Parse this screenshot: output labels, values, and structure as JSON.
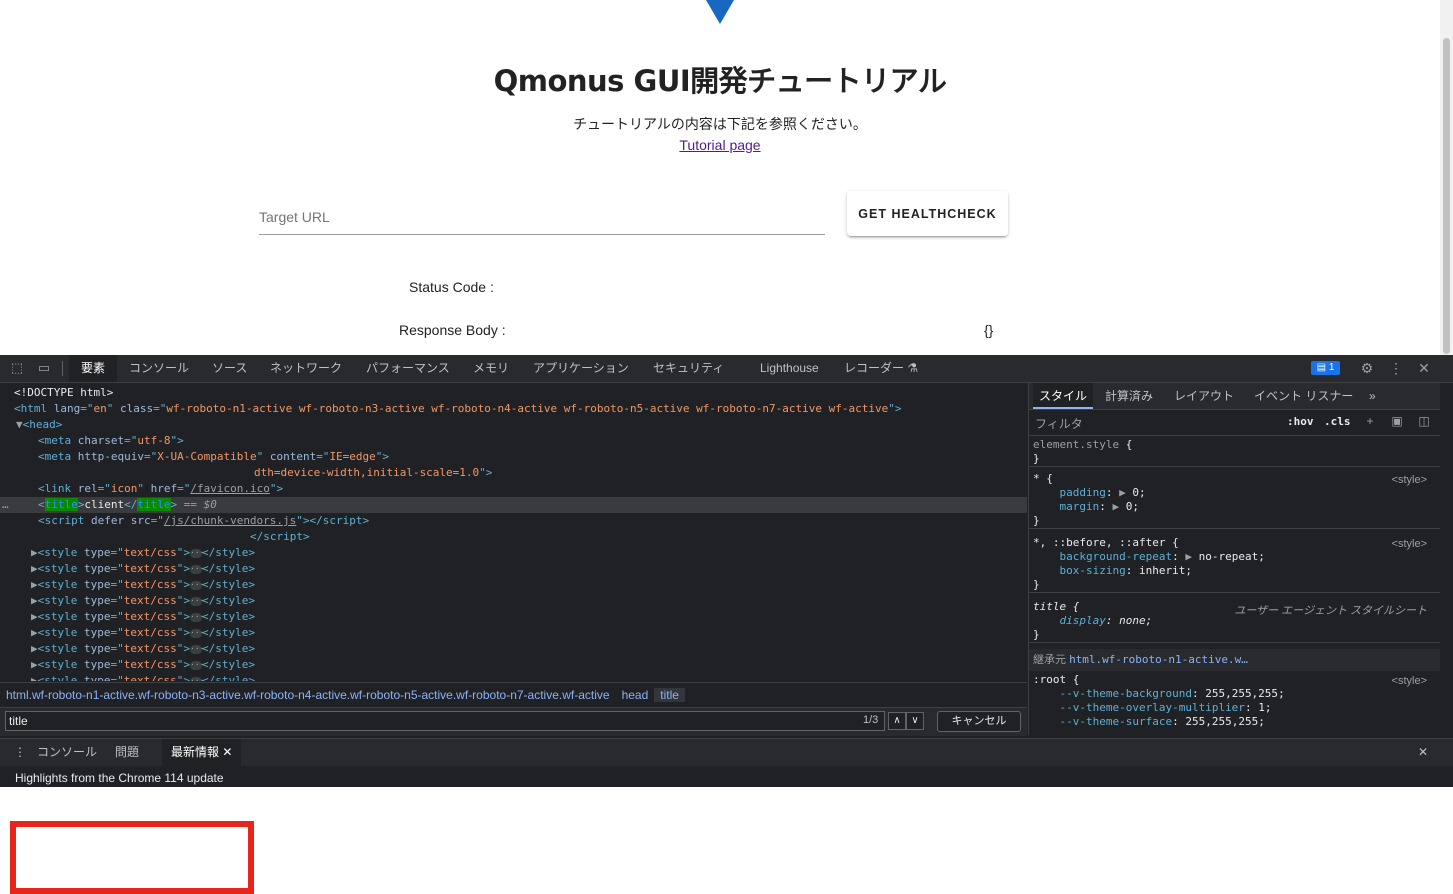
{
  "page": {
    "title": "Qmonus GUI開発チュートリアル",
    "description": "チュートリアルの内容は下記を参照ください。",
    "link": "Tutorial page",
    "url_placeholder": "Target URL",
    "healthcheck_button": "GET HEALTHCHECK",
    "status_label": "Status Code :",
    "response_label": "Response Body :",
    "response_value": "{}"
  },
  "devtools": {
    "tabs": [
      "要素",
      "コンソール",
      "ソース",
      "ネットワーク",
      "パフォーマンス",
      "メモリ",
      "アプリケーション",
      "セキュリティ",
      "Lighthouse",
      "レコーダー"
    ],
    "active_tab": "要素",
    "message_count": "1",
    "dom_lines": {
      "doctype": "<!DOCTYPE html>",
      "html_lang": "en",
      "html_class": "wf-roboto-n1-active wf-roboto-n3-active wf-roboto-n4-active wf-roboto-n5-active wf-roboto-n7-active wf-active",
      "meta_charset": "utf-8",
      "meta_http_equiv": "X-UA-Compatible",
      "meta_content": "IE=edge",
      "meta_viewport_tail": "dth=device-width,initial-scale=1.0",
      "link_rel": "icon",
      "link_href": "/favicon.ico",
      "title_text": "client",
      "selected_marker": "== $0",
      "script1_src": "/js/chunk-vendors.js",
      "script2_tail": "script>",
      "style_type": "text/css",
      "style_count": 9
    },
    "breadcrumbs": [
      "html.wf-roboto-n1-active.wf-roboto-n3-active.wf-roboto-n4-active.wf-roboto-n5-active.wf-roboto-n7-active.wf-active",
      "head",
      "title"
    ],
    "search": {
      "value": "title",
      "count": "1/3",
      "cancel": "キャンセル"
    },
    "styles": {
      "tabs": [
        "スタイル",
        "計算済み",
        "レイアウト",
        "イベント リスナー"
      ],
      "filter_placeholder": "フィルタ",
      "hov": ":hov",
      "cls": ".cls",
      "element_style": "element.style",
      "rule1_selector": "*",
      "rule1_source": "<style>",
      "rule1_props": [
        {
          "name": "padding",
          "value": "0"
        },
        {
          "name": "margin",
          "value": "0"
        }
      ],
      "rule2_selector": "*, ::before, ::after",
      "rule2_source": "<style>",
      "rule2_props": [
        {
          "name": "background-repeat",
          "value": "no-repeat"
        },
        {
          "name": "box-sizing",
          "value": "inherit"
        }
      ],
      "rule3_selector": "title",
      "rule3_source": "ユーザー エージェント スタイルシート",
      "rule3_props": [
        {
          "name": "display",
          "value": "none"
        }
      ],
      "inherited_label": "継承元",
      "inherited_from": "html.wf-roboto-n1-active.w…",
      "rule4_selector": ":root",
      "rule4_source": "<style>",
      "rule4_props": [
        {
          "name": "--v-theme-background",
          "value": "255,255,255"
        },
        {
          "name": "--v-theme-overlay-multiplier",
          "value": "1"
        },
        {
          "name": "--v-theme-surface",
          "value": "255,255,255"
        }
      ]
    },
    "drawer": {
      "tabs": [
        "コンソール",
        "問題",
        "最新情報"
      ],
      "active": "最新情報",
      "content": "Highlights from the Chrome 114 update"
    }
  }
}
